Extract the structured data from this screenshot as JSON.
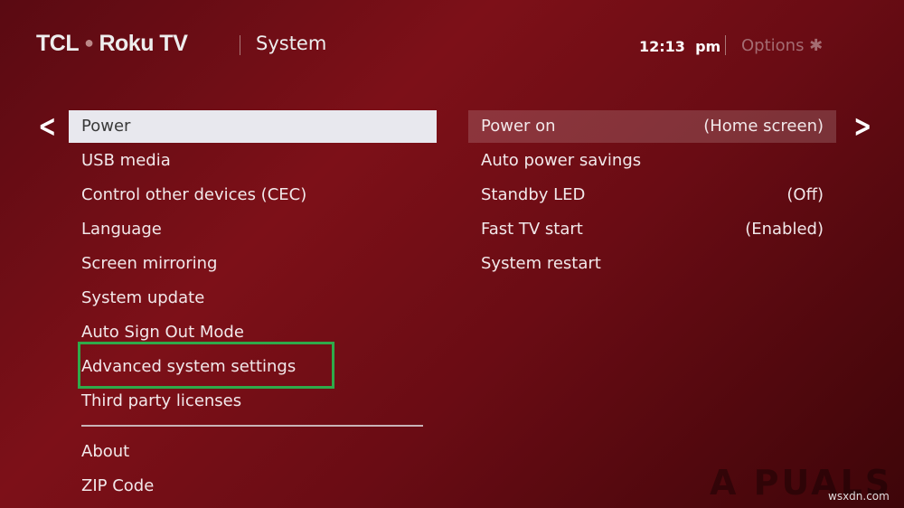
{
  "header": {
    "logo": "TCL • Roku TV",
    "logo_brand1": "TCL",
    "logo_brand2": "Roku TV",
    "title": "System",
    "time": "12:13  pm",
    "options": "Options ✱"
  },
  "left_menu": {
    "items": [
      {
        "label": "Power",
        "selected": true
      },
      {
        "label": "USB media"
      },
      {
        "label": "Control other devices (CEC)"
      },
      {
        "label": "Language"
      },
      {
        "label": "Screen mirroring"
      },
      {
        "label": "System update"
      },
      {
        "label": "Auto Sign Out Mode"
      },
      {
        "label": "Advanced system settings",
        "highlighted": true
      },
      {
        "label": "Third party licenses"
      }
    ],
    "extra_items": [
      {
        "label": "About"
      },
      {
        "label": "ZIP Code"
      }
    ]
  },
  "right_menu": {
    "items": [
      {
        "label": "Power on",
        "value": "(Home screen)",
        "selected": true
      },
      {
        "label": "Auto power savings",
        "value": ""
      },
      {
        "label": "Standby LED",
        "value": "(Off)"
      },
      {
        "label": "Fast TV start",
        "value": "(Enabled)"
      },
      {
        "label": "System restart",
        "value": ""
      }
    ]
  },
  "watermark": {
    "text": "APPUALS",
    "site": "wsxdn.com"
  },
  "colors": {
    "highlight_box": "#2faa4a",
    "background": "#6a0c14"
  }
}
